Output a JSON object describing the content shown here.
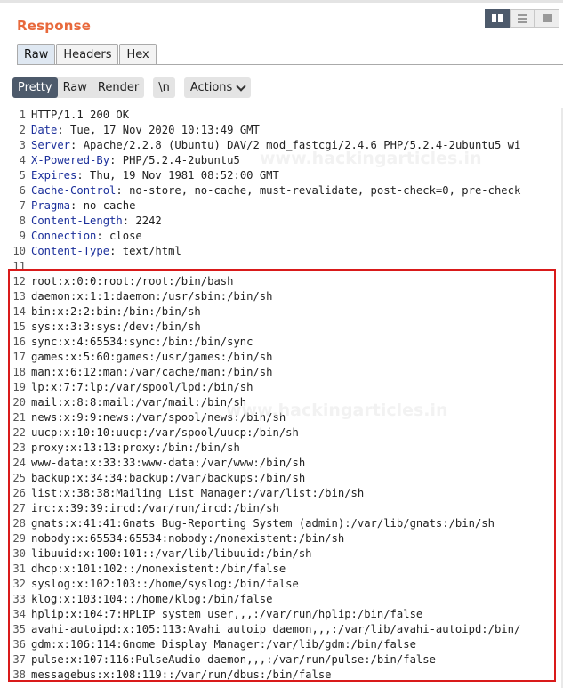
{
  "panel": {
    "title": "Response"
  },
  "layout_buttons": [
    {
      "name": "split-columns-layout-icon",
      "active": true
    },
    {
      "name": "split-rows-layout-icon",
      "active": false
    },
    {
      "name": "single-pane-layout-icon",
      "active": false
    }
  ],
  "view_tabs": [
    "Raw",
    "Headers",
    "Hex"
  ],
  "toolbar": {
    "pretty": "Pretty",
    "raw": "Raw",
    "render": "Render",
    "newline": "\\n",
    "actions": "Actions"
  },
  "watermarks": [
    "www.hackingarticles.in",
    "www.hackingarticles.in"
  ],
  "colors": {
    "accent": "#e8693c",
    "header_name": "#1b2f9b",
    "highlight_border": "#d91a1a",
    "active_button": "#4d5a6b"
  },
  "response_lines": [
    {
      "num": "1",
      "name": "",
      "value": "HTTP/1.1 200 OK"
    },
    {
      "num": "2",
      "name": "Date",
      "value": " Tue, 17 Nov 2020 10:13:49 GMT"
    },
    {
      "num": "3",
      "name": "Server",
      "value": " Apache/2.2.8 (Ubuntu) DAV/2 mod_fastcgi/2.4.6 PHP/5.2.4-2ubuntu5 wi"
    },
    {
      "num": "4",
      "name": "X-Powered-By",
      "value": " PHP/5.2.4-2ubuntu5"
    },
    {
      "num": "5",
      "name": "Expires",
      "value": " Thu, 19 Nov 1981 08:52:00 GMT"
    },
    {
      "num": "6",
      "name": "Cache-Control",
      "value": " no-store, no-cache, must-revalidate, post-check=0, pre-check"
    },
    {
      "num": "7",
      "name": "Pragma",
      "value": " no-cache"
    },
    {
      "num": "8",
      "name": "Content-Length",
      "value": " 2242"
    },
    {
      "num": "9",
      "name": "Connection",
      "value": " close"
    },
    {
      "num": "10",
      "name": "Content-Type",
      "value": " text/html"
    },
    {
      "num": "11",
      "name": "",
      "value": ""
    },
    {
      "num": "12",
      "name": "",
      "value": "root:x:0:0:root:/root:/bin/bash"
    },
    {
      "num": "13",
      "name": "",
      "value": "daemon:x:1:1:daemon:/usr/sbin:/bin/sh"
    },
    {
      "num": "14",
      "name": "",
      "value": "bin:x:2:2:bin:/bin:/bin/sh"
    },
    {
      "num": "15",
      "name": "",
      "value": "sys:x:3:3:sys:/dev:/bin/sh"
    },
    {
      "num": "16",
      "name": "",
      "value": "sync:x:4:65534:sync:/bin:/bin/sync"
    },
    {
      "num": "17",
      "name": "",
      "value": "games:x:5:60:games:/usr/games:/bin/sh"
    },
    {
      "num": "18",
      "name": "",
      "value": "man:x:6:12:man:/var/cache/man:/bin/sh"
    },
    {
      "num": "19",
      "name": "",
      "value": "lp:x:7:7:lp:/var/spool/lpd:/bin/sh"
    },
    {
      "num": "20",
      "name": "",
      "value": "mail:x:8:8:mail:/var/mail:/bin/sh"
    },
    {
      "num": "21",
      "name": "",
      "value": "news:x:9:9:news:/var/spool/news:/bin/sh"
    },
    {
      "num": "22",
      "name": "",
      "value": "uucp:x:10:10:uucp:/var/spool/uucp:/bin/sh"
    },
    {
      "num": "23",
      "name": "",
      "value": "proxy:x:13:13:proxy:/bin:/bin/sh"
    },
    {
      "num": "24",
      "name": "",
      "value": "www-data:x:33:33:www-data:/var/www:/bin/sh"
    },
    {
      "num": "25",
      "name": "",
      "value": "backup:x:34:34:backup:/var/backups:/bin/sh"
    },
    {
      "num": "26",
      "name": "",
      "value": "list:x:38:38:Mailing List Manager:/var/list:/bin/sh"
    },
    {
      "num": "27",
      "name": "",
      "value": "irc:x:39:39:ircd:/var/run/ircd:/bin/sh"
    },
    {
      "num": "28",
      "name": "",
      "value": "gnats:x:41:41:Gnats Bug-Reporting System (admin):/var/lib/gnats:/bin/sh"
    },
    {
      "num": "29",
      "name": "",
      "value": "nobody:x:65534:65534:nobody:/nonexistent:/bin/sh"
    },
    {
      "num": "30",
      "name": "",
      "value": "libuuid:x:100:101::/var/lib/libuuid:/bin/sh"
    },
    {
      "num": "31",
      "name": "",
      "value": "dhcp:x:101:102::/nonexistent:/bin/false"
    },
    {
      "num": "32",
      "name": "",
      "value": "syslog:x:102:103::/home/syslog:/bin/false"
    },
    {
      "num": "33",
      "name": "",
      "value": "klog:x:103:104::/home/klog:/bin/false"
    },
    {
      "num": "34",
      "name": "",
      "value": "hplip:x:104:7:HPLIP system user,,,:/var/run/hplip:/bin/false"
    },
    {
      "num": "35",
      "name": "",
      "value": "avahi-autoipd:x:105:113:Avahi autoip daemon,,,:/var/lib/avahi-autoipd:/bin/"
    },
    {
      "num": "36",
      "name": "",
      "value": "gdm:x:106:114:Gnome Display Manager:/var/lib/gdm:/bin/false"
    },
    {
      "num": "37",
      "name": "",
      "value": "pulse:x:107:116:PulseAudio daemon,,,:/var/run/pulse:/bin/false"
    },
    {
      "num": "38",
      "name": "",
      "value": "messagebus:x:108:119::/var/run/dbus:/bin/false"
    }
  ]
}
